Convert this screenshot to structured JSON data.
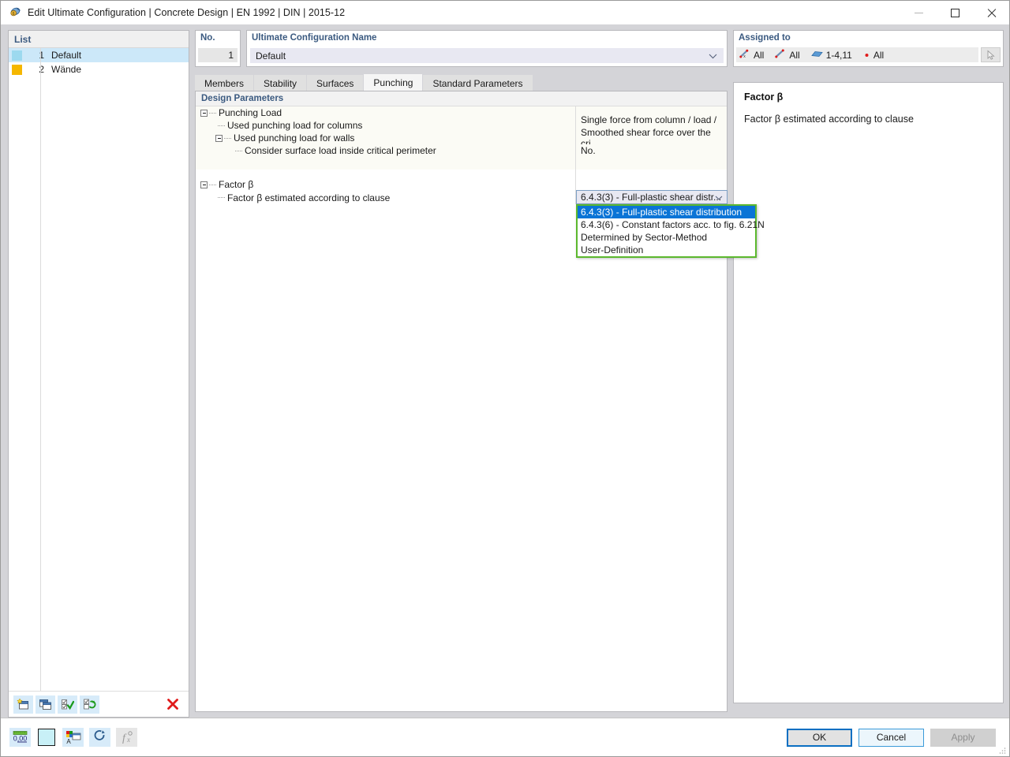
{
  "window": {
    "title": "Edit Ultimate Configuration | Concrete Design | EN 1992 | DIN | 2015-12",
    "icon": "concrete-design-icon",
    "minimize_label": "Minimize",
    "maximize_label": "Maximize",
    "close_label": "Close"
  },
  "list_panel": {
    "header": "List",
    "rows": [
      {
        "no": "1",
        "label": "Default",
        "color": "#9cd9ef",
        "selected": true
      },
      {
        "no": "2",
        "label": "Wände",
        "color": "#f5b700",
        "selected": false
      }
    ],
    "toolbar": [
      {
        "name": "new-configuration-button",
        "title": "New"
      },
      {
        "name": "copy-configuration-button",
        "title": "Copy"
      },
      {
        "name": "check-all-button",
        "title": "Select all"
      },
      {
        "name": "invert-selection-button",
        "title": "Invert selection"
      },
      {
        "name": "delete-configuration-button",
        "title": "Delete"
      }
    ]
  },
  "number_field": {
    "caption": "No.",
    "value": "1"
  },
  "name_field": {
    "caption": "Ultimate Configuration Name",
    "value": "Default"
  },
  "tabs": [
    {
      "label": "Members",
      "active": false
    },
    {
      "label": "Stability",
      "active": false
    },
    {
      "label": "Surfaces",
      "active": false
    },
    {
      "label": "Punching",
      "active": true
    },
    {
      "label": "Standard Parameters",
      "active": false
    }
  ],
  "design_parameters": {
    "header": "Design Parameters",
    "groups": [
      {
        "name": "Punching Load",
        "rows": [
          {
            "label": "Used punching load for columns",
            "value": "Single force from column / load / ...",
            "depth": 1,
            "expander": false
          },
          {
            "label": "Used punching load for walls",
            "value": "Smoothed shear force over the cri...",
            "depth": 1,
            "expander": true
          },
          {
            "label": "Consider surface load inside critical perimeter",
            "value": "No.",
            "depth": 2,
            "expander": false
          }
        ]
      },
      {
        "name": "Factor β",
        "rows": [
          {
            "label": "Factor β estimated according to clause",
            "value": "6.4.3(3) - Full-plastic shear distr...",
            "depth": 1,
            "expander": false,
            "editor": "combobox"
          }
        ]
      }
    ]
  },
  "dropdown": {
    "open": true,
    "selected_index": 0,
    "options": [
      "6.4.3(3) - Full-plastic shear distribution",
      "6.4.3(6) - Constant factors acc. to fig. 6.21N",
      "Determined by Sector-Method",
      "User-Definition"
    ],
    "highlight_color": "#0a74d6",
    "border_color": "#5cb82e"
  },
  "assigned_to": {
    "caption": "Assigned to",
    "entries": [
      {
        "icon": "member-ribs-icon",
        "value": "All"
      },
      {
        "icon": "member-icon",
        "value": "All"
      },
      {
        "icon": "surface-icon",
        "value": "1-4,11"
      },
      {
        "icon": "node-icon",
        "value": "All"
      }
    ],
    "pick_button": "pick-in-graphic-button"
  },
  "info_panel": {
    "title": "Factor β",
    "text": "Factor β estimated according to clause"
  },
  "footer": {
    "tools": [
      {
        "name": "units-decimal-places-button",
        "label": "0,00"
      },
      {
        "name": "color-swatch-button",
        "color": "#c8f0f7"
      },
      {
        "name": "display-properties-button"
      },
      {
        "name": "reset-defaults-button"
      },
      {
        "name": "formula-button",
        "disabled": true
      }
    ],
    "buttons": [
      {
        "name": "ok-button",
        "label": "OK",
        "style": "ok"
      },
      {
        "name": "cancel-button",
        "label": "Cancel",
        "style": "cancel"
      },
      {
        "name": "apply-button",
        "label": "Apply",
        "style": "apply"
      }
    ]
  }
}
